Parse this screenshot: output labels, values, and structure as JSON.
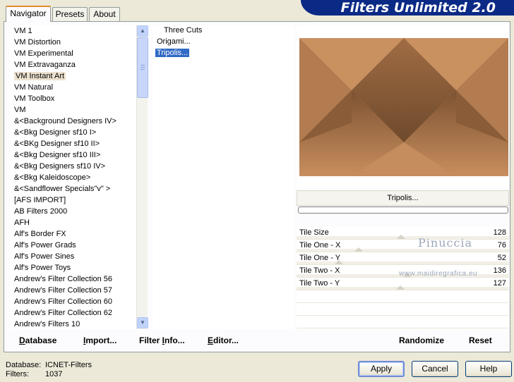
{
  "app": {
    "title": "Filters Unlimited 2.0"
  },
  "tabs": [
    {
      "label": "Navigator",
      "active": true
    },
    {
      "label": "Presets",
      "active": false
    },
    {
      "label": "About",
      "active": false
    }
  ],
  "categories": {
    "selected": "VM Instant Art",
    "items": [
      "VM 1",
      "VM Distortion",
      "VM Experimental",
      "VM Extravaganza",
      "VM Instant Art",
      "VM Natural",
      "VM Toolbox",
      "VM",
      "&<Background Designers IV>",
      "&<Bkg Designer sf10 I>",
      "&<BKg Designer sf10 II>",
      "&<Bkg Designer sf10 III>",
      "&<Bkg Designers sf10 IV>",
      "&<Bkg Kaleidoscope>",
      "&<Sandflower Specials\"v\" >",
      "[AFS IMPORT]",
      "AB Filters 2000",
      "AFH",
      "Alf's Border FX",
      "Alf's Power Grads",
      "Alf's Power Sines",
      "Alf's Power Toys",
      "Andrew's Filter Collection 56",
      "Andrew's Filter Collection 57",
      "Andrew's Filter Collection 60",
      "Andrew's Filter Collection 62",
      "Andrew's Filters 10"
    ]
  },
  "filters": {
    "selected": "Tripolis...",
    "items": [
      "Three Cuts",
      "Origami...",
      "Tripolis..."
    ]
  },
  "preview": {
    "filter_name": "Tripolis...",
    "colors": {
      "light": "#d49a6a",
      "mid": "#b07a50",
      "dark": "#7a5232"
    }
  },
  "params": [
    {
      "label": "Tile Size",
      "value": "128",
      "level": 0.502
    },
    {
      "label": "Tile One - X",
      "value": "76",
      "level": 0.298
    },
    {
      "label": "Tile One - Y",
      "value": "52",
      "level": 0.204
    },
    {
      "label": "Tile Two - X",
      "value": "136",
      "level": 0.533
    },
    {
      "label": "Tile Two - Y",
      "value": "127",
      "level": 0.498
    }
  ],
  "watermark": {
    "name": "Pinuccia",
    "site": "www.maidiregrafica.eu"
  },
  "panel_buttons": {
    "database": {
      "accel": "D",
      "rest": "atabase"
    },
    "import": {
      "accel": "I",
      "rest": "mport..."
    },
    "filter_info": {
      "pre": "Filter ",
      "accel": "I",
      "rest": "nfo..."
    },
    "editor": {
      "accel": "E",
      "rest": "ditor..."
    },
    "randomize": "Randomize",
    "reset": "Reset"
  },
  "status": {
    "database_label": "Database:",
    "database_value": "ICNET-Filters",
    "filters_label": "Filters:",
    "filters_value": "1037"
  },
  "dialog_buttons": {
    "apply": "Apply",
    "cancel": "Cancel",
    "help": "Help"
  }
}
